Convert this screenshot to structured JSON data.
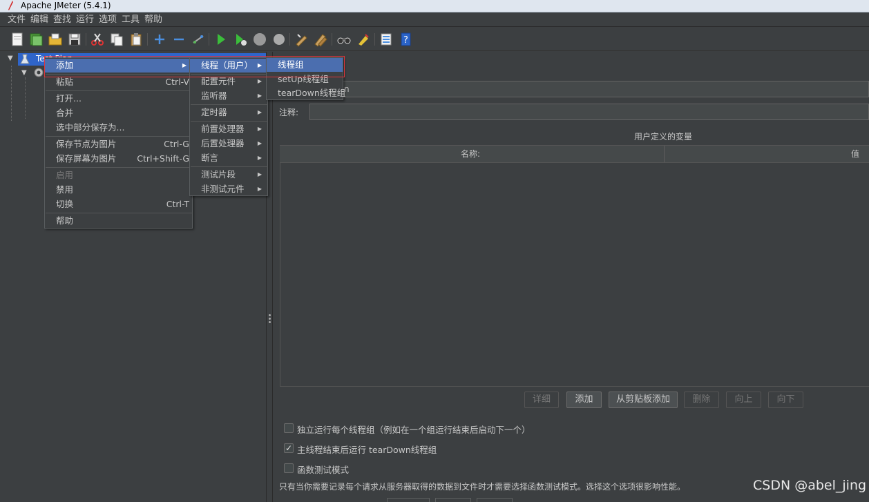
{
  "window": {
    "title": "Apache JMeter (5.4.1)"
  },
  "menubar": {
    "items": [
      "文件",
      "编辑",
      "查找",
      "运行",
      "选项",
      "工具",
      "帮助"
    ]
  },
  "toolbar": {
    "icons": [
      "new-icon",
      "templates-icon",
      "open-icon",
      "save-icon",
      "cut-icon",
      "copy-icon",
      "paste-icon",
      "expand-icon",
      "collapse-icon",
      "toggle-icon",
      "start-icon",
      "start-no-pause-icon",
      "stop-icon",
      "shutdown-icon",
      "clear-icon",
      "clear-all-icon",
      "search-icon",
      "reset-search-icon",
      "function-helper-icon",
      "help-icon"
    ]
  },
  "tree": {
    "root_label": "Test Plan"
  },
  "right_pane": {
    "name_value_partial": "n",
    "comment_label": "注释:",
    "vars_title": "用户定义的变量",
    "table_columns": [
      "名称:",
      "值"
    ],
    "buttons": {
      "detail": "详细",
      "add": "添加",
      "add_from_clipboard": "从剪贴板添加",
      "delete": "删除",
      "up": "向上",
      "down": "向下"
    },
    "checkboxes": [
      {
        "label": "独立运行每个线程组（例如在一个组运行结束后启动下一个）",
        "checked": false
      },
      {
        "label": "主线程结束后运行 tearDown线程组",
        "checked": true
      },
      {
        "label": "函数测试模式",
        "checked": false
      }
    ],
    "note": "只有当你需要记录每个请求从服务器取得的数据到文件时才需要选择函数测试模式。选择这个选项很影响性能。"
  },
  "context_menu": {
    "items": [
      {
        "label": "添加",
        "shortcut": "",
        "submenu": true
      },
      {
        "label": "粘贴",
        "shortcut": "Ctrl-V"
      },
      {
        "label": "打开...",
        "shortcut": ""
      },
      {
        "label": "合并",
        "shortcut": ""
      },
      {
        "label": "选中部分保存为...",
        "shortcut": ""
      },
      {
        "label": "保存节点为图片",
        "shortcut": "Ctrl-G"
      },
      {
        "label": "保存屏幕为图片",
        "shortcut": "Ctrl+Shift-G"
      },
      {
        "label": "启用",
        "shortcut": "",
        "disabled": true
      },
      {
        "label": "禁用",
        "shortcut": ""
      },
      {
        "label": "切换",
        "shortcut": "Ctrl-T"
      },
      {
        "label": "帮助",
        "shortcut": ""
      }
    ]
  },
  "add_submenu": {
    "items": [
      "线程（用户）",
      "配置元件",
      "监听器",
      "定时器",
      "前置处理器",
      "后置处理器",
      "断言",
      "测试片段",
      "非测试元件"
    ]
  },
  "threads_submenu": {
    "items": [
      "线程组",
      "setUp线程组",
      "tearDown线程组"
    ]
  },
  "watermark": "CSDN @abel_jing"
}
